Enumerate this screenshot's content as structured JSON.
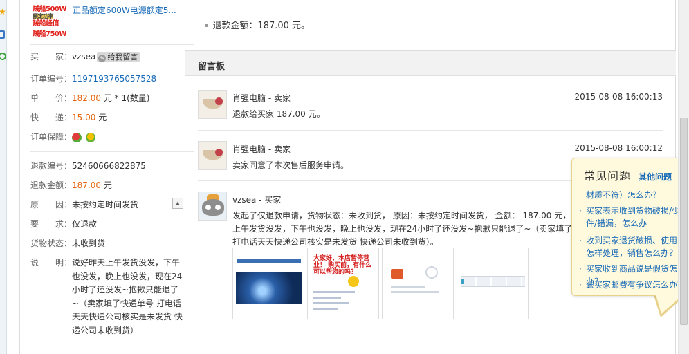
{
  "product": {
    "thumb_lines": [
      "贼船500W",
      "额定功率",
      "贼船峰值",
      "贼船750W"
    ],
    "title": "正品额定600W电源额定5..."
  },
  "order": {
    "buyer_label": "买　　家：",
    "buyer": "vzsea",
    "message_button": "给我留言",
    "order_no_label": "订单编号：",
    "order_no": "1197193765057528",
    "price_label": "单　　价：",
    "price": "182.00",
    "price_suffix": "元 * 1(数量)",
    "shipping_label": "快　　递：",
    "shipping": "15.00",
    "shipping_suffix": "元",
    "guarantee_label": "订单保障："
  },
  "refund": {
    "refund_no_label": "退款编号：",
    "refund_no": "52460666822875",
    "refund_amount_label": "退款金额：",
    "refund_amount": "187.00",
    "refund_amount_suffix": "元",
    "reason_label": "原　　因：",
    "reason": "未按约定时间发货",
    "request_label": "要　　求：",
    "request": "仅退款",
    "goods_status_label": "货物状态：",
    "goods_status": "未收到货",
    "desc_label": "说　　明：",
    "desc": "说好昨天上午发货没发，下午也没发，晚上也没发，现在24小时了还没发~抱歉只能退了~（卖家填了快递单号 打电话天天快递公司核实是未发货 快递公司未收到货）"
  },
  "top_refund_text": "退款金额：187.00 元。",
  "board": {
    "title": "留言板",
    "messages": [
      {
        "name": "肖强电脑 - 卖家",
        "time": "2015-08-08 16:00:13",
        "text": "退款给买家 187.00 元。"
      },
      {
        "name": "肖强电脑 - 卖家",
        "time": "2015-08-08 16:00:12",
        "text": "卖家同意了本次售后服务申请。"
      },
      {
        "name": "vzsea - 买家",
        "time": "",
        "text": "发起了仅退款申请，货物状态：未收到货， 原因：未按约定时间发货， 金额： 187.00 元，说好昨天上午发货没发，下午也没发，晚上也没发，现在24小时了还没发~抱歉只能退了~（卖家填了快递单号 打电话天天快递公司核实是未发货 快递公司未收到货）。"
      }
    ],
    "attachment2_text": "大家好，本店暂停营业！ 购买前，有什么可以帮您的吗？"
  },
  "faq": {
    "title": "常见问题",
    "more": "其他问题",
    "items": [
      "材质不符）怎么办？",
      "买家表示收到货物破损/少件/错漏，怎么办",
      "收到买家退货破损、使用，怎样处理，销售怎么办？",
      "买家收到商品说是假货怎么办？",
      "跟买家邮费有争议怎么办？"
    ]
  }
}
